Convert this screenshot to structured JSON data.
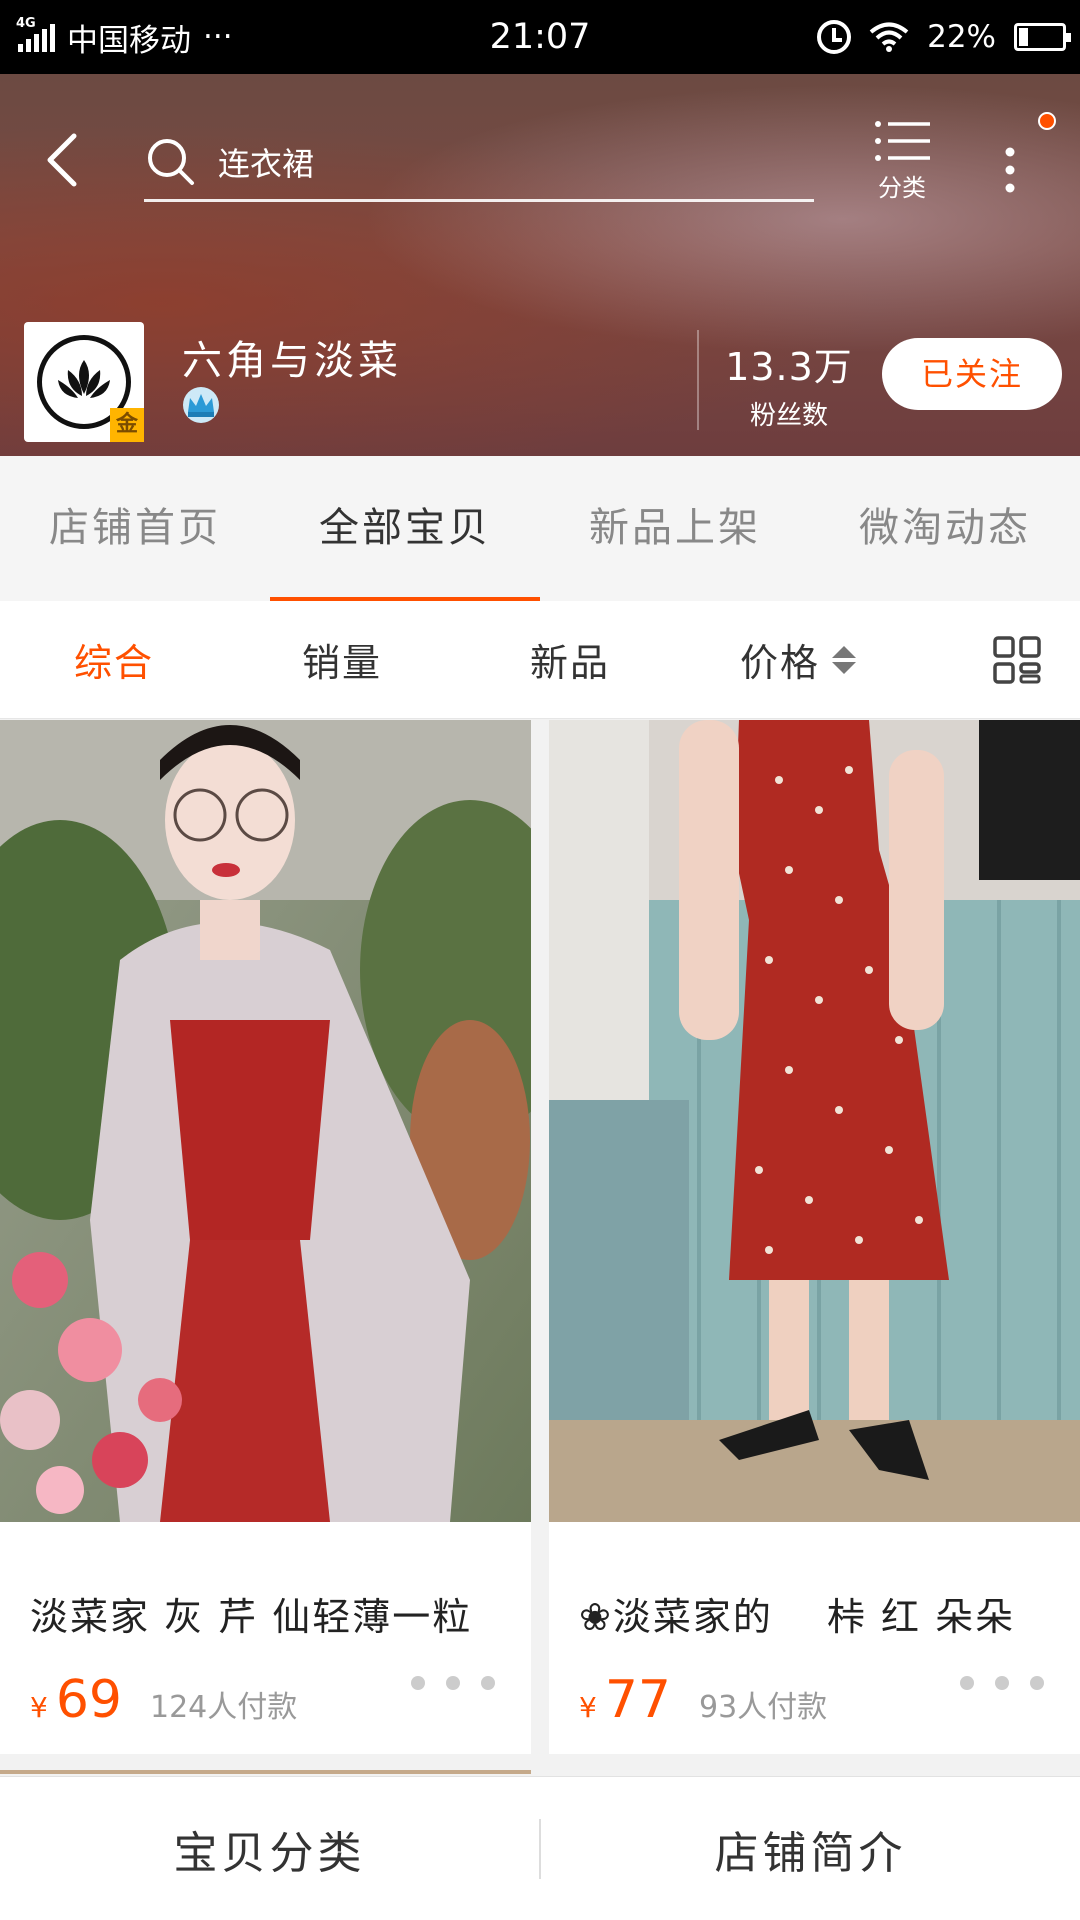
{
  "status_bar": {
    "network": "4G",
    "carrier": "中国移动",
    "more": "···",
    "time": "21:07",
    "battery": "22%"
  },
  "header": {
    "search_query": "连衣裙",
    "category_label": "分类"
  },
  "shop": {
    "name": "六角与淡菜",
    "badge": "金",
    "fans_count": "13.3万",
    "fans_label": "粉丝数",
    "follow_label": "已关注"
  },
  "tabs": [
    {
      "label": "店铺首页",
      "active": false
    },
    {
      "label": "全部宝贝",
      "active": true
    },
    {
      "label": "新品上架",
      "active": false
    },
    {
      "label": "微淘动态",
      "active": false
    }
  ],
  "sort": {
    "items": [
      {
        "label": "综合",
        "active": true
      },
      {
        "label": "销量",
        "active": false
      },
      {
        "label": "新品",
        "active": false
      },
      {
        "label": "价格",
        "active": false
      }
    ]
  },
  "products": [
    {
      "title": "淡菜家 灰 芹 仙轻薄一粒",
      "currency": "¥",
      "price": "69",
      "sold": "124人付款"
    },
    {
      "title": "❀淡菜家的　 桛 红 朵朵",
      "currency": "¥",
      "price": "77",
      "sold": "93人付款"
    }
  ],
  "bottom_bar": {
    "category_label": "宝贝分类",
    "intro_label": "店铺简介"
  },
  "colors": {
    "accent": "#ff5000",
    "header_bg": "#7a4b44"
  }
}
